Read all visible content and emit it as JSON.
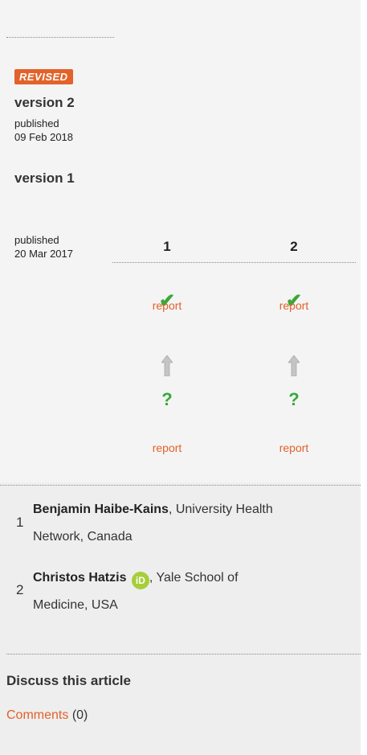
{
  "badge": "REVISED",
  "versions": [
    {
      "title": "version 2",
      "published_label": "published",
      "date": "09 Feb 2018"
    },
    {
      "title": "version 1",
      "published_label": "published",
      "date": "20 Mar 2017"
    }
  ],
  "reviewer_columns": [
    "1",
    "2"
  ],
  "report_label": "report",
  "referees": [
    {
      "number": "1",
      "name": "Benjamin Haibe-Kains",
      "affiliation": ", University Health",
      "affiliation2": "Network, Canada"
    },
    {
      "number": "2",
      "name": "Christos Hatzis",
      "orcid_label": "iD",
      "affiliation": ", Yale School of",
      "affiliation2": "Medicine, USA"
    }
  ],
  "discuss": {
    "title": "Discuss this article",
    "comments_link": "Comments",
    "comments_count": "(0)"
  },
  "colors": {
    "accent": "#e2622a",
    "approved": "#39a839",
    "orcid": "#a6ce39"
  },
  "icons": {
    "approved": "checkmark-icon",
    "unclear": "question-icon",
    "arrow": "up-arrow-icon"
  }
}
